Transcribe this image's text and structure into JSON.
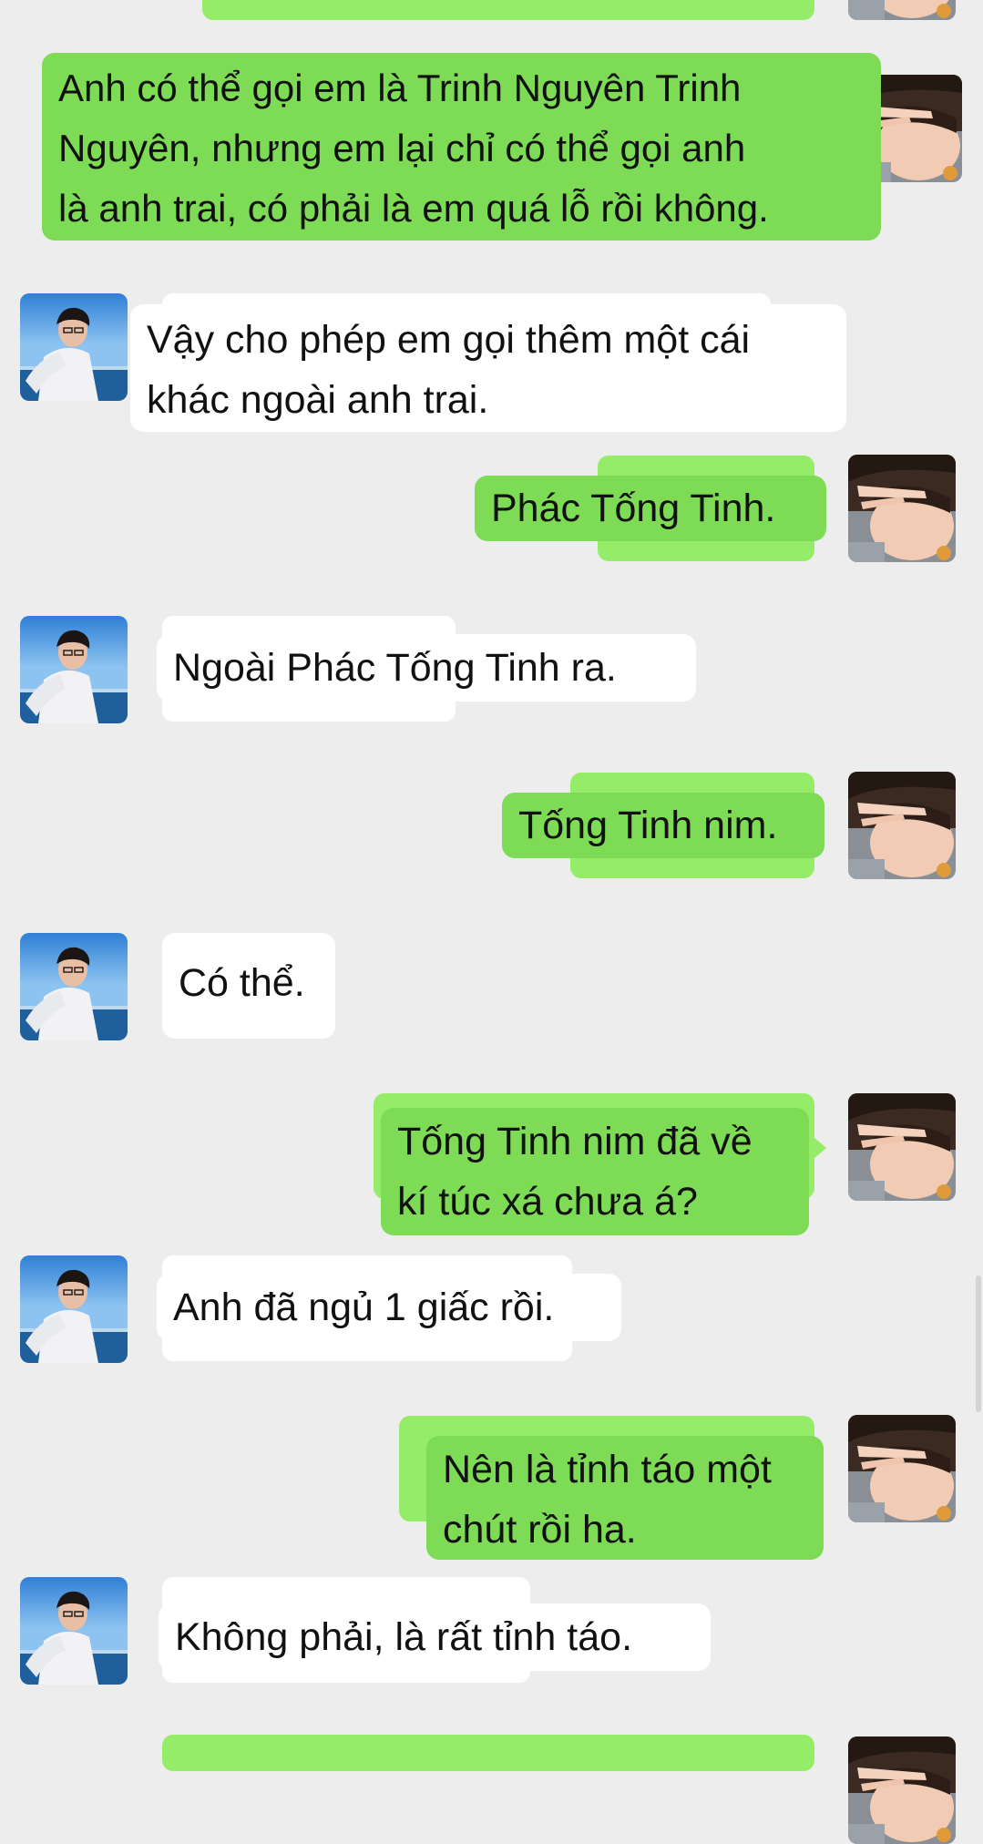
{
  "conversation": {
    "contact_avatar": "photo-avatar-boy-by-sea",
    "self_avatar": "photo-avatar-hand-over-face",
    "colors": {
      "background": "#ededed",
      "outgoing_bubble": "#7ddb55",
      "outgoing_bubble_ghost": "#95ec69",
      "incoming_bubble": "#ffffff"
    },
    "messages": [
      {
        "from": "self",
        "lines": [
          "Anh có thể gọi em là Trinh Nguyên Trinh",
          "Nguyên, nhưng em lại chỉ có thể gọi anh",
          "là anh trai, có phải là em quá lỗ rồi không."
        ]
      },
      {
        "from": "contact",
        "lines": [
          "Vậy cho phép em gọi thêm một cái",
          "khác ngoài anh trai."
        ]
      },
      {
        "from": "self",
        "lines": [
          "Phác Tống Tinh."
        ]
      },
      {
        "from": "contact",
        "lines": [
          "Ngoài Phác Tống Tinh ra."
        ]
      },
      {
        "from": "self",
        "lines": [
          "Tống Tinh nim."
        ]
      },
      {
        "from": "contact",
        "lines": [
          "Có thể."
        ]
      },
      {
        "from": "self",
        "lines": [
          "Tống Tinh nim đã về",
          "kí túc xá chưa á?"
        ]
      },
      {
        "from": "contact",
        "lines": [
          "Anh đã ngủ 1 giấc rồi."
        ]
      },
      {
        "from": "self",
        "lines": [
          "Nên là tỉnh táo một",
          "chút rồi ha."
        ]
      },
      {
        "from": "contact",
        "lines": [
          "Không phải, là rất tỉnh táo."
        ]
      }
    ]
  }
}
